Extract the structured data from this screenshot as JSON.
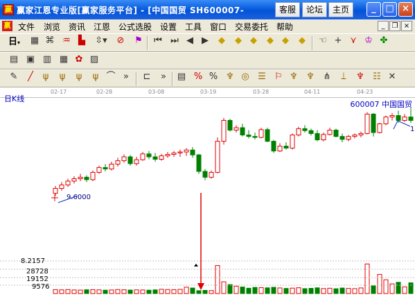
{
  "window": {
    "title": "赢家江恩专业版[赢家服务平台] - [中国国贸 SH600007-",
    "buttons": [
      "客服",
      "论坛",
      "主页"
    ],
    "controls": [
      "_",
      "□",
      "×"
    ]
  },
  "menu": [
    "文件",
    "浏览",
    "资讯",
    "江恩",
    "公式选股",
    "设置",
    "工具",
    "窗口",
    "交易委托",
    "帮助"
  ],
  "toolbar": {
    "period_select": "日"
  },
  "chart": {
    "period": "日K线",
    "stock_code": "600007",
    "stock_name": "中国国贸",
    "dates": [
      "02-17",
      "02-28",
      "03-08",
      "03-19",
      "03-28",
      "04-11",
      "04-23"
    ],
    "low_label": "9.6000",
    "high_label": "1",
    "volume_axis": [
      "8.2157",
      "28728",
      "19152",
      "9576"
    ]
  },
  "chart_data": {
    "type": "candlestick",
    "ohlc": [
      [
        9.55,
        9.7,
        9.5,
        9.65
      ],
      [
        9.65,
        9.78,
        9.6,
        9.72
      ],
      [
        9.72,
        9.85,
        9.68,
        9.8
      ],
      [
        9.8,
        9.9,
        9.75,
        9.85
      ],
      [
        9.85,
        9.95,
        9.8,
        9.88
      ],
      [
        9.88,
        9.92,
        9.78,
        9.83
      ],
      [
        9.83,
        10.02,
        9.8,
        9.98
      ],
      [
        9.98,
        10.12,
        9.95,
        10.08
      ],
      [
        10.08,
        10.15,
        10.0,
        10.05
      ],
      [
        10.05,
        10.2,
        10.02,
        10.15
      ],
      [
        10.15,
        10.28,
        10.1,
        10.22
      ],
      [
        10.22,
        10.35,
        10.18,
        10.3
      ],
      [
        10.3,
        10.34,
        10.12,
        10.16
      ],
      [
        10.16,
        10.3,
        10.12,
        10.24
      ],
      [
        10.24,
        10.4,
        10.22,
        10.36
      ],
      [
        10.36,
        10.42,
        10.25,
        10.3
      ],
      [
        10.3,
        10.38,
        10.2,
        10.25
      ],
      [
        10.25,
        10.36,
        10.22,
        10.32
      ],
      [
        10.32,
        10.4,
        10.28,
        10.35
      ],
      [
        10.35,
        10.42,
        10.3,
        10.38
      ],
      [
        10.38,
        10.45,
        10.3,
        10.4
      ],
      [
        10.4,
        10.48,
        10.32,
        10.44
      ],
      [
        10.44,
        10.5,
        10.28,
        10.34
      ],
      [
        10.34,
        10.36,
        9.95,
        10.0
      ],
      [
        10.0,
        10.05,
        9.82,
        9.88
      ],
      [
        9.88,
        10.02,
        9.85,
        9.98
      ],
      [
        9.98,
        10.7,
        9.96,
        10.62
      ],
      [
        10.62,
        11.1,
        10.55,
        11.05
      ],
      [
        11.05,
        11.08,
        10.82,
        10.85
      ],
      [
        10.85,
        10.95,
        10.8,
        10.9
      ],
      [
        10.9,
        10.98,
        10.72,
        10.75
      ],
      [
        10.75,
        10.85,
        10.68,
        10.72
      ],
      [
        10.72,
        10.8,
        10.66,
        10.7
      ],
      [
        10.7,
        10.9,
        10.68,
        10.86
      ],
      [
        10.86,
        10.9,
        10.6,
        10.62
      ],
      [
        10.62,
        10.65,
        10.38,
        10.42
      ],
      [
        10.42,
        10.58,
        10.4,
        10.52
      ],
      [
        10.52,
        10.6,
        10.45,
        10.48
      ],
      [
        10.48,
        10.78,
        10.45,
        10.75
      ],
      [
        10.75,
        10.92,
        10.72,
        10.88
      ],
      [
        10.88,
        10.95,
        10.8,
        10.84
      ],
      [
        10.84,
        10.88,
        10.74,
        10.78
      ],
      [
        10.78,
        10.85,
        10.62,
        10.65
      ],
      [
        10.65,
        10.8,
        10.62,
        10.76
      ],
      [
        10.76,
        10.9,
        10.74,
        10.85
      ],
      [
        10.85,
        10.88,
        10.7,
        10.72
      ],
      [
        10.72,
        10.78,
        10.6,
        10.66
      ],
      [
        10.66,
        10.75,
        10.62,
        10.72
      ],
      [
        10.72,
        10.78,
        10.68,
        10.75
      ],
      [
        10.75,
        10.82,
        10.7,
        10.78
      ],
      [
        10.78,
        11.22,
        10.76,
        11.18
      ],
      [
        11.18,
        11.2,
        10.72,
        10.8
      ],
      [
        10.8,
        11.0,
        10.78,
        10.98
      ],
      [
        10.98,
        11.15,
        10.95,
        11.12
      ],
      [
        11.12,
        11.2,
        11.05,
        11.15
      ],
      [
        11.15,
        11.25,
        11.0,
        11.05
      ],
      [
        11.05,
        11.18,
        11.02,
        11.12
      ],
      [
        11.12,
        11.3,
        11.0,
        11.05
      ]
    ],
    "volume": [
      3800,
      3600,
      3900,
      3500,
      3400,
      3700,
      3800,
      3600,
      3300,
      3500,
      3900,
      3700,
      3400,
      3600,
      3500,
      3300,
      3600,
      4200,
      3900,
      3800,
      4100,
      6200,
      5400,
      2800,
      3100,
      2900,
      27500,
      11500,
      8800,
      7200,
      6400,
      5200,
      6000,
      5800,
      5600,
      6100,
      5500,
      5000,
      5300,
      5700,
      4800,
      5100,
      5600,
      4900,
      5200,
      4700,
      5400,
      5000,
      4800,
      5500,
      29000,
      7500,
      18800,
      13500,
      9500,
      11000,
      6500,
      10500
    ],
    "ylim": [
      9.3,
      11.3
    ],
    "vol_max": 32000
  }
}
